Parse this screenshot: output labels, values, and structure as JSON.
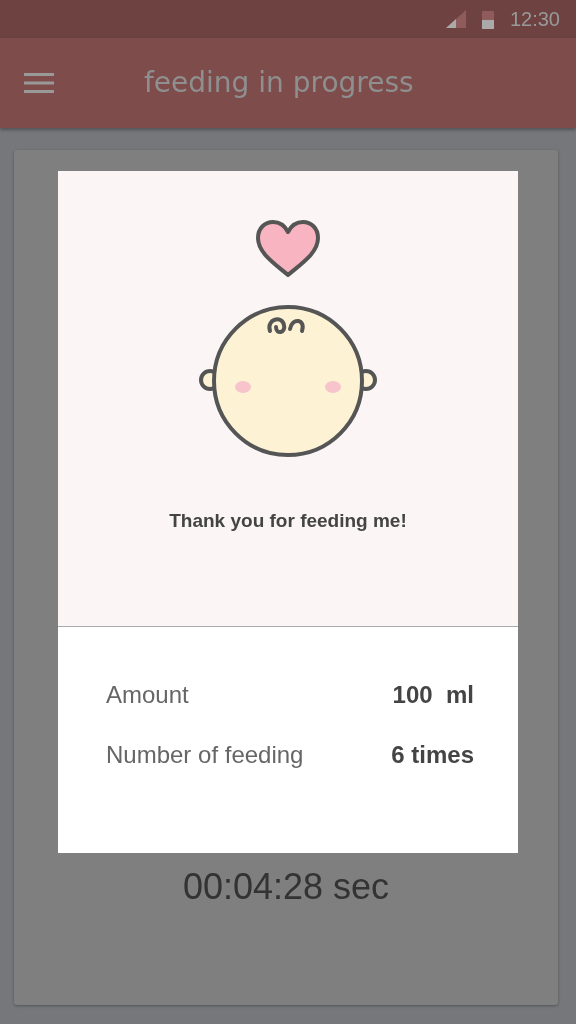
{
  "status_bar": {
    "time": "12:30"
  },
  "app_bar": {
    "title": "feeding in progress"
  },
  "timer": {
    "text": "00:04:28 sec"
  },
  "dialog": {
    "message": "Thank you for feeding me!",
    "stats": [
      {
        "label": "Amount",
        "value": "100  ml"
      },
      {
        "label": "Number of feeding",
        "value": "6 times"
      }
    ]
  }
}
